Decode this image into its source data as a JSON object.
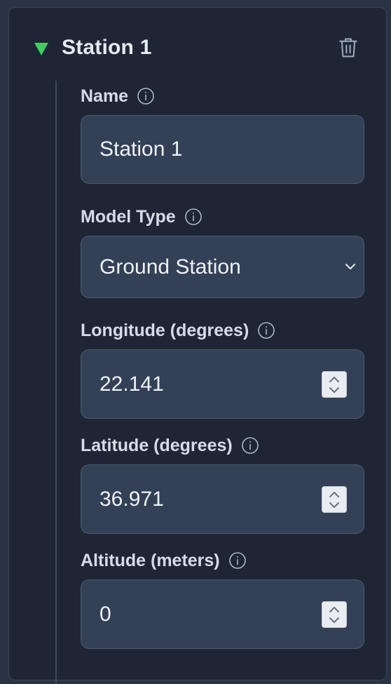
{
  "station": {
    "title": "Station 1",
    "toggle_icon": "triangle-down-icon",
    "delete_icon": "trash-icon",
    "accent": "#3ecf5f"
  },
  "fields": {
    "name": {
      "label": "Name",
      "value": "Station 1"
    },
    "model_type": {
      "label": "Model Type",
      "value": "Ground Station"
    },
    "longitude": {
      "label": "Longitude (degrees)",
      "value": "22.141"
    },
    "latitude": {
      "label": "Latitude (degrees)",
      "value": "36.971"
    },
    "altitude": {
      "label": "Altitude (meters)",
      "value": "0"
    }
  }
}
